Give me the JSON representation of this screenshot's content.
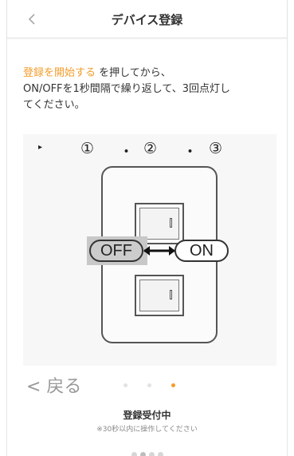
{
  "header": {
    "back_icon": "chevron-left-icon",
    "title": "デバイス登録"
  },
  "instruction": {
    "accent_text": "登録を開始する",
    "line1_rest": " を押してから、",
    "line2": "ON/OFFを1秒間隔で繰り返して、3回点灯し",
    "line3": "てください。"
  },
  "illustration": {
    "play_icon": "▸",
    "steps": [
      "①",
      "・",
      "②",
      "・",
      "③"
    ],
    "off_label": "OFF",
    "on_label": "ON",
    "arrow_icon": "double-arrow-icon"
  },
  "navigation": {
    "back_label": "< 戻る",
    "page_count": 3,
    "active_page": 3,
    "colors": {
      "active": "#f39c2b",
      "inactive": "#e2e2e2"
    }
  },
  "status": {
    "title": "登録受付中",
    "note": "※30秒以内に操作してください"
  },
  "loader": {
    "dots": 4
  },
  "colors": {
    "accent": "#f39c2b"
  }
}
